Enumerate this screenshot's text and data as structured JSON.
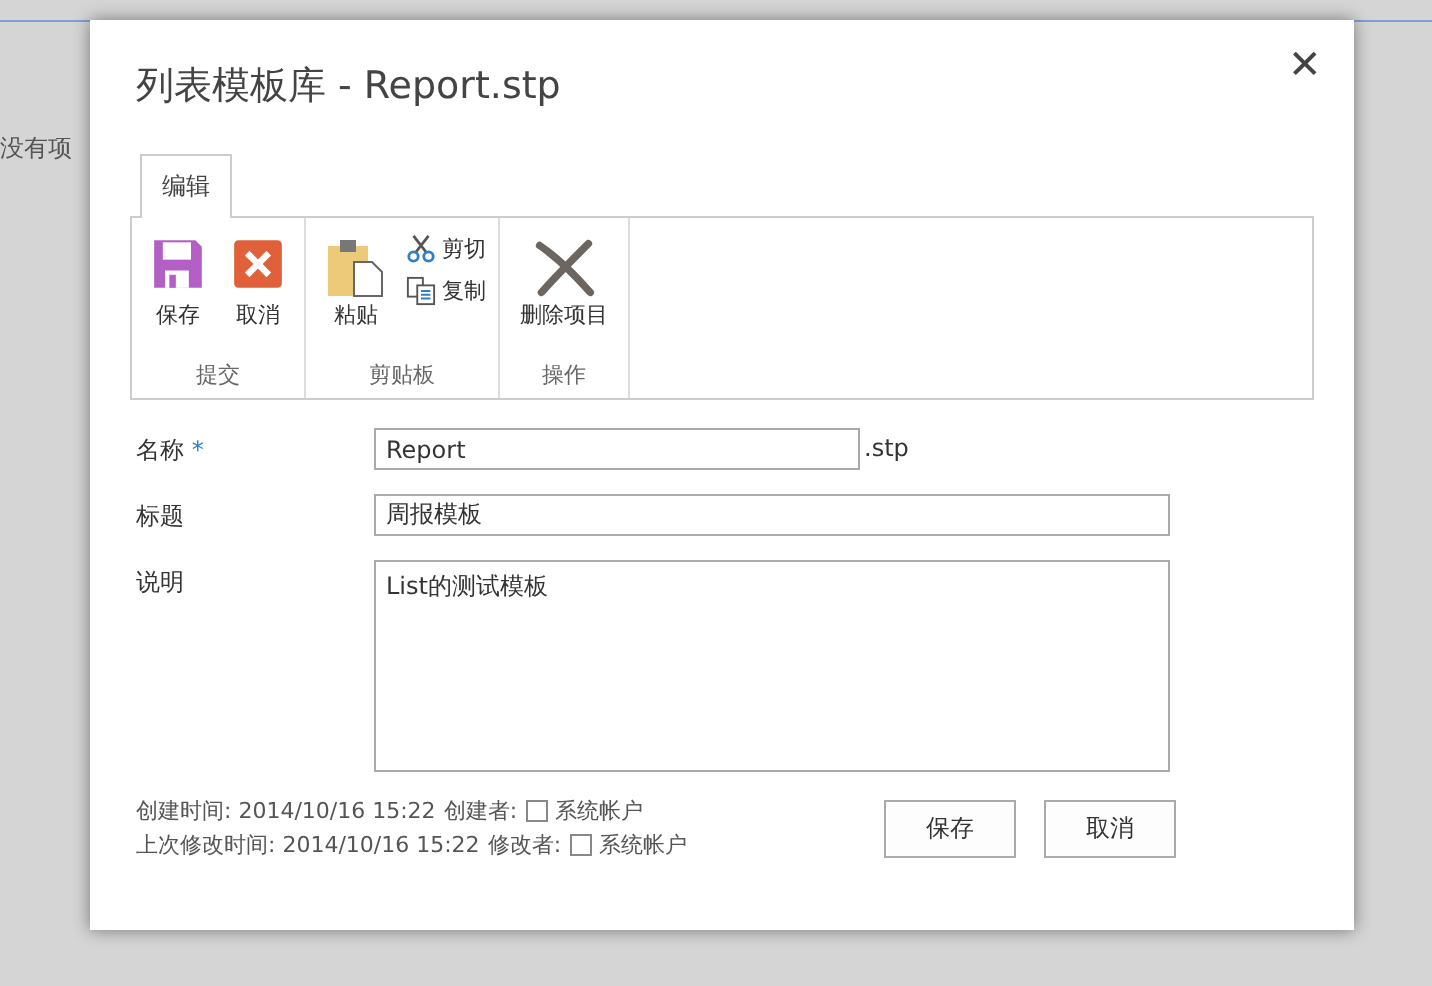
{
  "background": {
    "texts": [
      "没有项"
    ]
  },
  "dialog": {
    "title": "列表模板库 - Report.stp",
    "close": "✕",
    "tabs": [
      {
        "label": "编辑",
        "selected": true
      }
    ],
    "ribbon_groups": [
      {
        "label": "提交",
        "items": [
          {
            "kind": "large",
            "label": "保存"
          },
          {
            "kind": "large",
            "label": "取消"
          }
        ]
      },
      {
        "label": "剪贴板",
        "items": [
          {
            "kind": "large",
            "label": "粘贴"
          },
          {
            "kind": "small",
            "label": "剪切"
          },
          {
            "kind": "small",
            "label": "复制"
          }
        ]
      },
      {
        "label": "操作",
        "items": [
          {
            "kind": "large",
            "label": "删除项目"
          }
        ]
      }
    ],
    "fields": [
      {
        "kind": "input",
        "label": "名称",
        "required": true,
        "value": "Report",
        "suffix": ".stp"
      },
      {
        "kind": "input",
        "label": "标题",
        "required": false,
        "value": "周报模板"
      },
      {
        "kind": "textarea",
        "label": "说明",
        "required": false,
        "value": "List的测试模板"
      }
    ],
    "required_mark": "*",
    "meta": [
      {
        "label": "创建时间: 2014/10/16 15:22",
        "by_label": "创建者:",
        "user": "系统帐户"
      },
      {
        "label": "上次修改时间: 2014/10/16 15:22",
        "by_label": "修改者:",
        "user": "系统帐户"
      }
    ],
    "buttons": [
      "保存",
      "取消"
    ]
  }
}
